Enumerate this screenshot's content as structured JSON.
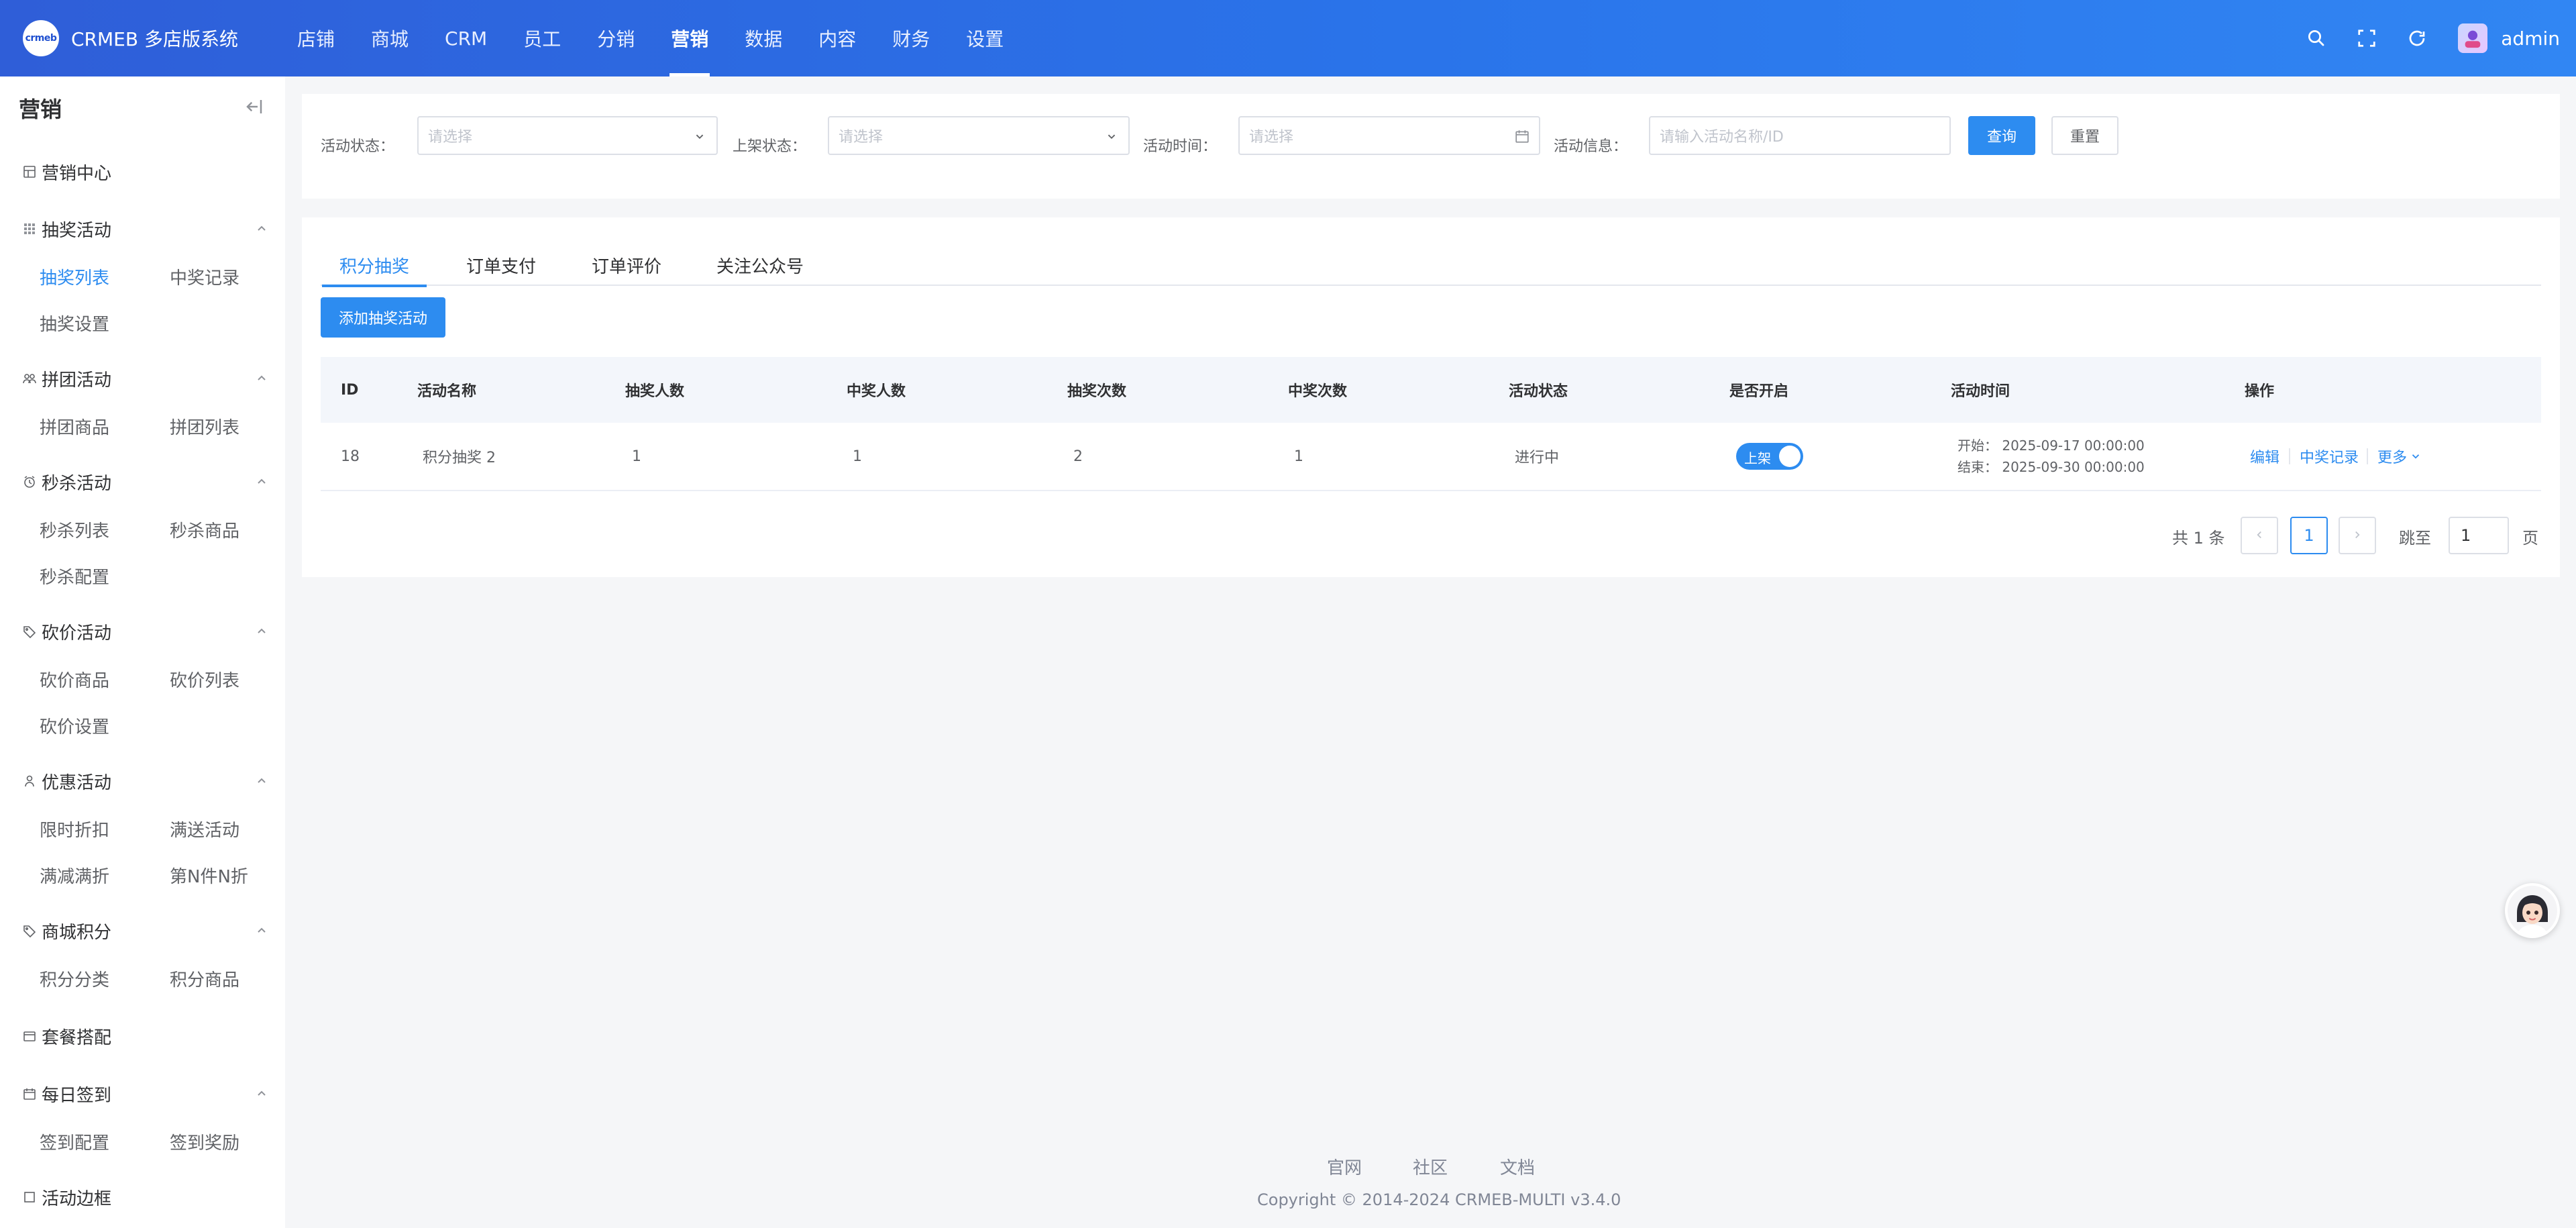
{
  "header": {
    "logo_mark": "crmeb",
    "logo_text": "CRMEB 多店版系统",
    "nav": [
      "店铺",
      "商城",
      "CRM",
      "员工",
      "分销",
      "营销",
      "数据",
      "内容",
      "财务",
      "设置"
    ],
    "active_nav": "营销",
    "user": "admin"
  },
  "sidebar": {
    "title": "营销",
    "center": "营销中心",
    "groups": [
      {
        "label": "抽奖活动",
        "items": [
          "抽奖列表",
          "中奖记录",
          "抽奖设置"
        ]
      },
      {
        "label": "拼团活动",
        "items": [
          "拼团商品",
          "拼团列表"
        ]
      },
      {
        "label": "秒杀活动",
        "items": [
          "秒杀列表",
          "秒杀商品",
          "秒杀配置"
        ]
      },
      {
        "label": "砍价活动",
        "items": [
          "砍价商品",
          "砍价列表",
          "砍价设置"
        ]
      },
      {
        "label": "优惠活动",
        "items": [
          "限时折扣",
          "满送活动",
          "满减满折",
          "第N件N折"
        ]
      },
      {
        "label": "商城积分",
        "items": [
          "积分分类",
          "积分商品"
        ]
      },
      {
        "label": "套餐搭配",
        "items": []
      },
      {
        "label": "每日签到",
        "items": [
          "签到配置",
          "签到奖励"
        ]
      },
      {
        "label": "活动边框",
        "items": []
      }
    ],
    "active_item": "抽奖列表"
  },
  "filters": {
    "status_label": "活动状态：",
    "status_placeholder": "请选择",
    "shelf_label": "上架状态：",
    "shelf_placeholder": "请选择",
    "time_label": "活动时间：",
    "time_placeholder": "请选择",
    "info_label": "活动信息：",
    "info_placeholder": "请输入活动名称/ID",
    "query_button": "查询",
    "reset_button": "重置"
  },
  "tabs": [
    "积分抽奖",
    "订单支付",
    "订单评价",
    "关注公众号"
  ],
  "active_tab": "积分抽奖",
  "add_button": "添加抽奖活动",
  "table": {
    "columns": [
      "ID",
      "活动名称",
      "抽奖人数",
      "中奖人数",
      "抽奖次数",
      "中奖次数",
      "活动状态",
      "是否开启",
      "活动时间",
      "操作"
    ],
    "rows": [
      {
        "id": "18",
        "name": "积分抽奖 2",
        "draw_people": "1",
        "win_people": "1",
        "draw_times": "2",
        "win_times": "1",
        "status": "进行中",
        "enabled_label": "上架",
        "enabled": true,
        "start": "开始：  2025-09-17 00:00:00",
        "end": "结束：  2025-09-30 00:00:00",
        "actions": [
          "编辑",
          "中奖记录",
          "更多"
        ]
      }
    ]
  },
  "pagination": {
    "total": "共 1 条",
    "current_page": "1",
    "jump_label": "跳至",
    "jump_value": "1",
    "page_suffix": "页"
  },
  "footer": {
    "links": [
      "官网",
      "社区",
      "文档"
    ],
    "copyright": "Copyright © 2014-2024 CRMEB-MULTI v3.4.0"
  },
  "colors": {
    "accent": "#2d8cf0",
    "header_start": "#2f5ed8",
    "header_end": "#3186f3"
  }
}
